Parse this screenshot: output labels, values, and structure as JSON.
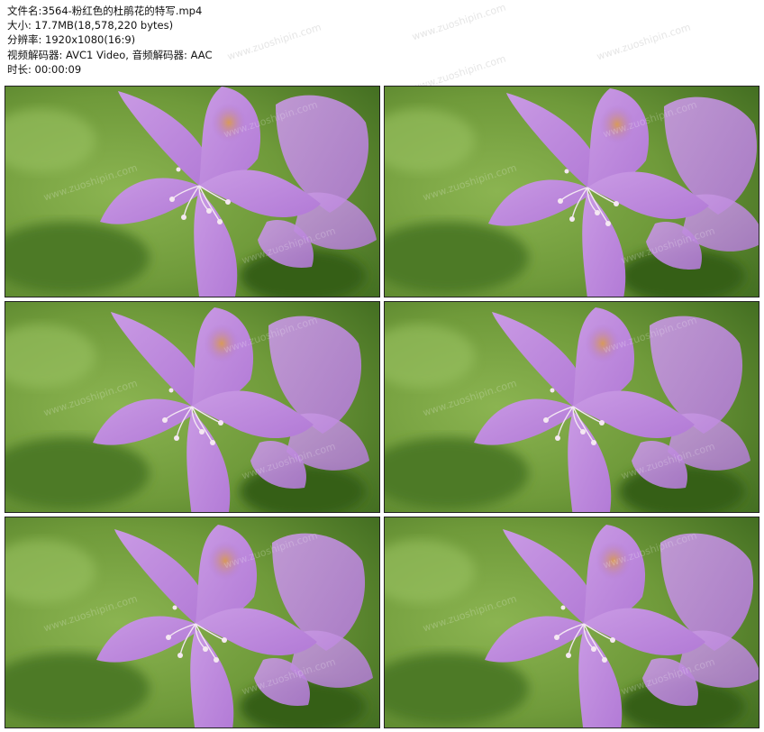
{
  "info": {
    "filename_label": "文件名:",
    "filename": "3564-粉红色的杜鹃花的特写.mp4",
    "size_label": "大小:",
    "size": "17.7MB(18,578,220 bytes)",
    "resolution_label": "分辨率:",
    "resolution": "1920x1080(16:9)",
    "codec_label": "视频解码器:",
    "codec": "AVC1 Video, 音频解码器: AAC",
    "duration_label": "时长:",
    "duration": "00:00:09"
  },
  "watermark": "www.zuoshipin.com",
  "colors": {
    "background_green": "#6f9a3a",
    "petal_purple": "#b27ad6",
    "petal_light": "#c99ae4",
    "throat_orange": "#d89a5a"
  }
}
